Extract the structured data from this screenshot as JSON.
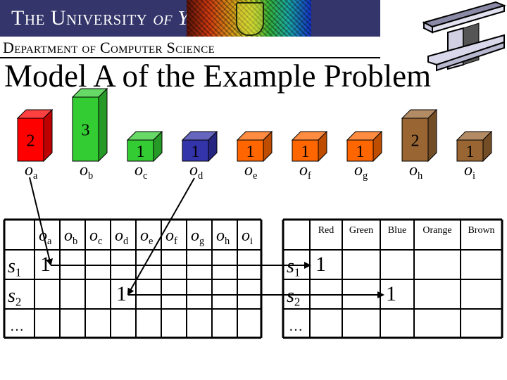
{
  "header": {
    "university": "The University",
    "university_of": "of York",
    "department": "Department of Computer Science"
  },
  "slide": {
    "title": "Model A of the Example Problem"
  },
  "colors": {
    "banner": "#34356a",
    "red": "#ff0000",
    "green": "#33cc33",
    "blue": "#3333aa",
    "orange": "#ff6600",
    "brown": "#996633"
  },
  "objects": [
    {
      "name": "o",
      "sub": "a",
      "size": 2,
      "color": "red"
    },
    {
      "name": "o",
      "sub": "b",
      "size": 3,
      "color": "green"
    },
    {
      "name": "o",
      "sub": "c",
      "size": 1,
      "color": "green"
    },
    {
      "name": "o",
      "sub": "d",
      "size": 1,
      "color": "blue"
    },
    {
      "name": "o",
      "sub": "e",
      "size": 1,
      "color": "orange"
    },
    {
      "name": "o",
      "sub": "f",
      "size": 1,
      "color": "orange"
    },
    {
      "name": "o",
      "sub": "g",
      "size": 1,
      "color": "orange"
    },
    {
      "name": "o",
      "sub": "h",
      "size": 2,
      "color": "brown"
    },
    {
      "name": "o",
      "sub": "i",
      "size": 1,
      "color": "brown"
    }
  ],
  "assignment_table": {
    "columns": [
      "a",
      "b",
      "c",
      "d",
      "e",
      "f",
      "g",
      "h",
      "i"
    ],
    "rows": [
      {
        "label": "s",
        "sub": "1",
        "cells": [
          "1",
          "",
          "",
          "",
          "",
          "",
          "",
          "",
          ""
        ]
      },
      {
        "label": "s",
        "sub": "2",
        "cells": [
          "",
          "",
          "",
          "1",
          "",
          "",
          "",
          "",
          ""
        ]
      },
      {
        "label": "…",
        "sub": "",
        "cells": [
          "",
          "",
          "",
          "",
          "",
          "",
          "",
          "",
          ""
        ]
      }
    ]
  },
  "color_table": {
    "columns": [
      "Red",
      "Green",
      "Blue",
      "Orange",
      "Brown"
    ],
    "rows": [
      {
        "label": "s",
        "sub": "1",
        "cells": [
          "1",
          "",
          "",
          "",
          ""
        ]
      },
      {
        "label": "s",
        "sub": "2",
        "cells": [
          "",
          "",
          "1",
          "",
          ""
        ]
      },
      {
        "label": "…",
        "sub": "",
        "cells": [
          "",
          "",
          "",
          "",
          ""
        ]
      }
    ]
  },
  "arrows": [
    {
      "from": "object-a",
      "to": "assignment s1,a"
    },
    {
      "from": "object-d",
      "to": "assignment s2,d"
    },
    {
      "from": "assignment row s1",
      "to": "color s1,Red"
    },
    {
      "from": "assignment row s2",
      "to": "color s2,Blue"
    }
  ]
}
